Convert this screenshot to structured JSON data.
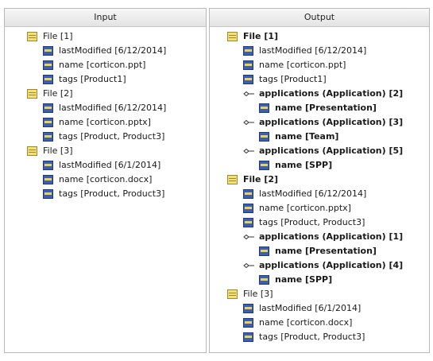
{
  "input": {
    "header": "Input",
    "rows": [
      {
        "label": "File [1]",
        "icon": "entity",
        "level": 0,
        "bold": false
      },
      {
        "label": "lastModified [6/12/2014]",
        "icon": "attribute",
        "level": 1,
        "bold": false
      },
      {
        "label": "name [corticon.ppt]",
        "icon": "attribute",
        "level": 1,
        "bold": false
      },
      {
        "label": "tags [Product1]",
        "icon": "attribute",
        "level": 1,
        "bold": false
      },
      {
        "label": "File [2]",
        "icon": "entity",
        "level": 0,
        "bold": false
      },
      {
        "label": "lastModified [6/12/2014]",
        "icon": "attribute",
        "level": 1,
        "bold": false
      },
      {
        "label": "name [corticon.pptx]",
        "icon": "attribute",
        "level": 1,
        "bold": false
      },
      {
        "label": "tags [Product, Product3]",
        "icon": "attribute",
        "level": 1,
        "bold": false
      },
      {
        "label": "File [3]",
        "icon": "entity",
        "level": 0,
        "bold": false
      },
      {
        "label": "lastModified [6/1/2014]",
        "icon": "attribute",
        "level": 1,
        "bold": false
      },
      {
        "label": "name [corticon.docx]",
        "icon": "attribute",
        "level": 1,
        "bold": false
      },
      {
        "label": "tags [Product, Product3]",
        "icon": "attribute",
        "level": 1,
        "bold": false
      }
    ]
  },
  "output": {
    "header": "Output",
    "rows": [
      {
        "label": "File [1]",
        "icon": "entity",
        "level": 0,
        "bold": true
      },
      {
        "label": "lastModified [6/12/2014]",
        "icon": "attribute",
        "level": 1,
        "bold": false
      },
      {
        "label": "name [corticon.ppt]",
        "icon": "attribute",
        "level": 1,
        "bold": false
      },
      {
        "label": "tags [Product1]",
        "icon": "attribute",
        "level": 1,
        "bold": false
      },
      {
        "label": "applications (Application) [2]",
        "icon": "association",
        "level": 1,
        "bold": true
      },
      {
        "label": "name [Presentation]",
        "icon": "attribute",
        "level": 2,
        "bold": true
      },
      {
        "label": "applications (Application) [3]",
        "icon": "association",
        "level": 1,
        "bold": true
      },
      {
        "label": "name [Team]",
        "icon": "attribute",
        "level": 2,
        "bold": true
      },
      {
        "label": "applications (Application) [5]",
        "icon": "association",
        "level": 1,
        "bold": true
      },
      {
        "label": "name [SPP]",
        "icon": "attribute",
        "level": 2,
        "bold": true
      },
      {
        "label": "File [2]",
        "icon": "entity",
        "level": 0,
        "bold": true
      },
      {
        "label": "lastModified [6/12/2014]",
        "icon": "attribute",
        "level": 1,
        "bold": false
      },
      {
        "label": "name [corticon.pptx]",
        "icon": "attribute",
        "level": 1,
        "bold": false
      },
      {
        "label": "tags [Product, Product3]",
        "icon": "attribute",
        "level": 1,
        "bold": false
      },
      {
        "label": "applications (Application) [1]",
        "icon": "association",
        "level": 1,
        "bold": true
      },
      {
        "label": "name [Presentation]",
        "icon": "attribute",
        "level": 2,
        "bold": true
      },
      {
        "label": "applications (Application) [4]",
        "icon": "association",
        "level": 1,
        "bold": true
      },
      {
        "label": "name [SPP]",
        "icon": "attribute",
        "level": 2,
        "bold": true
      },
      {
        "label": "File [3]",
        "icon": "entity",
        "level": 0,
        "bold": false
      },
      {
        "label": "lastModified [6/1/2014]",
        "icon": "attribute",
        "level": 1,
        "bold": false
      },
      {
        "label": "name [corticon.docx]",
        "icon": "attribute",
        "level": 1,
        "bold": false
      },
      {
        "label": "tags [Product, Product3]",
        "icon": "attribute",
        "level": 1,
        "bold": false
      }
    ]
  }
}
